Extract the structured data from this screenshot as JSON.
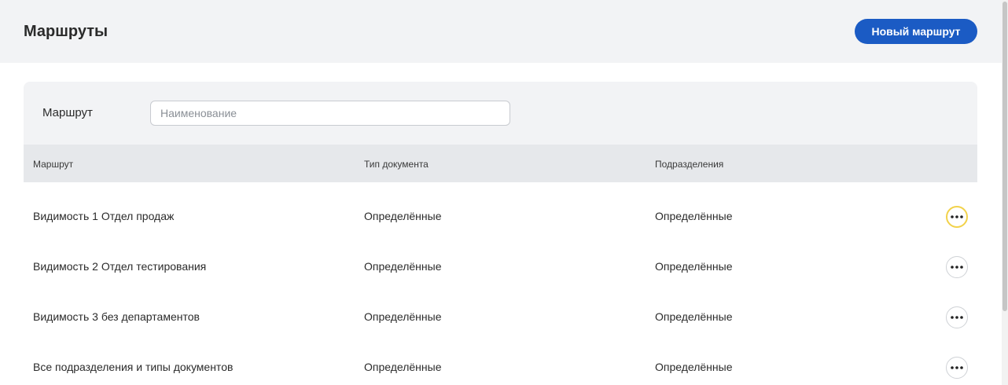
{
  "header": {
    "title": "Маршруты",
    "new_route_label": "Новый маршрут"
  },
  "filter": {
    "label": "Маршрут",
    "placeholder": "Наименование",
    "value": ""
  },
  "table": {
    "columns": [
      "Маршрут",
      "Тип документа",
      "Подразделения"
    ],
    "rows": [
      {
        "name": "Видимость 1 Отдел продаж",
        "doc_type": "Определённые",
        "departments": "Определённые"
      },
      {
        "name": "Видимость 2 Отдел тестирования",
        "doc_type": "Определённые",
        "departments": "Определённые"
      },
      {
        "name": "Видимость 3 без департаментов",
        "doc_type": "Определённые",
        "departments": "Определённые"
      },
      {
        "name": "Все подразделения и типы документов",
        "doc_type": "Определённые",
        "departments": "Определённые"
      }
    ],
    "row_action_icon": "more-horizontal-icon"
  },
  "colors": {
    "accent": "#1b5bc4",
    "header_bg": "#f2f3f5",
    "table_header_bg": "#e6e8eb",
    "focus_ring": "#f2d24a"
  }
}
